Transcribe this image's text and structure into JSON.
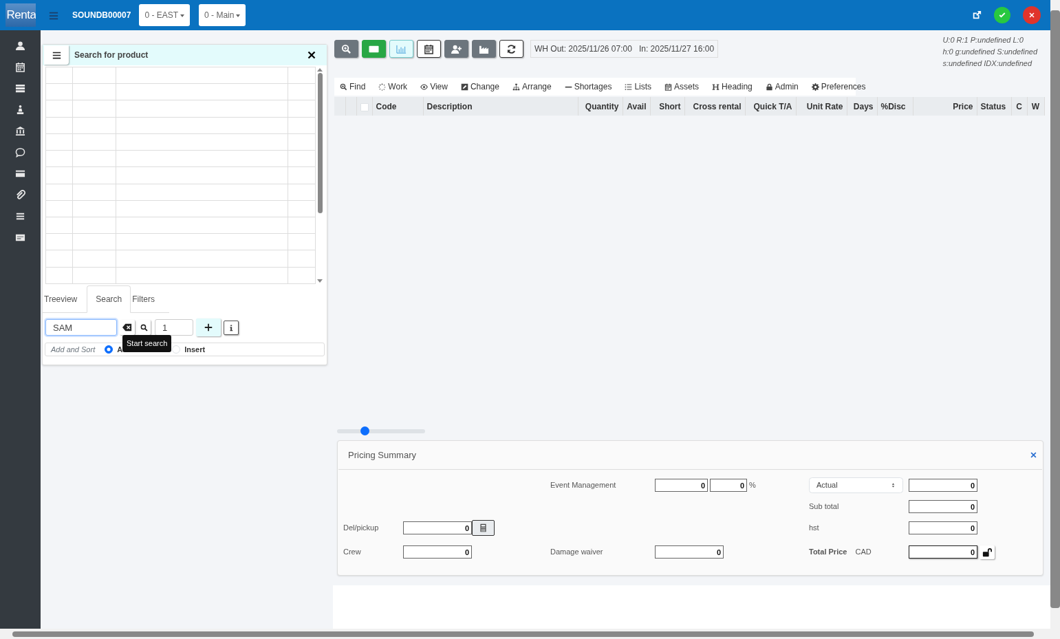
{
  "header": {
    "logo": "Renta",
    "order_code": "SOUNDB00007",
    "dropdowns": [
      "0 - EAST",
      "0 - Main"
    ]
  },
  "product_search": {
    "title": "Search for product",
    "tabs": [
      {
        "label": "Treeview",
        "selected": false
      },
      {
        "label": "Search",
        "selected": true
      },
      {
        "label": "Filters",
        "selected": false
      }
    ],
    "search_value": "SAM",
    "quantity": "1",
    "tooltip": "Start search",
    "add_mode_label": "Add and Sort",
    "add_options": [
      {
        "label": "A",
        "selected": true
      },
      {
        "label": "Insert",
        "selected": false
      }
    ]
  },
  "wh_dates": [
    "WH Out: 2025/11/26 07:00",
    "In: 2025/11/27 16:00"
  ],
  "debug_info": [
    "U:0 R:1 P:undefined L:0",
    "h:0 g:undefined S:undefined",
    "s:undefined IDX:undefined"
  ],
  "menu": [
    "Find",
    "Work",
    "View",
    "Change",
    "Arrange",
    "Shortages",
    "Lists",
    "Assets",
    "Heading",
    "Admin",
    "Preferences"
  ],
  "table": {
    "select_all_checked": false,
    "columns": [
      "Code",
      "Description",
      "Quantity",
      "Avail",
      "Short",
      "Cross rental",
      "Quick T/A",
      "Unit Rate",
      "Days",
      "%Disc",
      "Price",
      "Status",
      "C",
      "W"
    ]
  },
  "slider": {
    "level": 0.31
  },
  "pricing_summary": {
    "title": "Pricing Summary",
    "event_management": {
      "label": "Event Management",
      "value": "0",
      "percent": "0",
      "unit": "%"
    },
    "basis": {
      "value": "Actual",
      "amount": "0"
    },
    "sub_total": {
      "label": "Sub total",
      "value": "0"
    },
    "del_pickup": {
      "label": "Del/pickup",
      "value": "0"
    },
    "hst": {
      "label": "hst",
      "value": "0"
    },
    "crew": {
      "label": "Crew",
      "value": "0"
    },
    "damage_waiver": {
      "label": "Damage waiver",
      "value": "0"
    },
    "total_price": {
      "label": "Total Price",
      "currency": "CAD",
      "value": "0",
      "locked": false
    }
  }
}
